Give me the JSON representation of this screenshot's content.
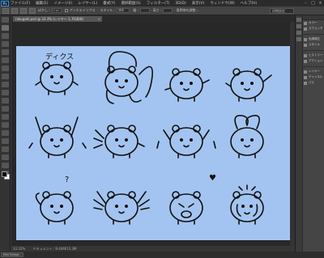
{
  "app": {
    "logo": "Ps"
  },
  "menu": [
    "ファイル(F)",
    "編集(E)",
    "イメージ(I)",
    "レイヤー(L)",
    "書式(Y)",
    "選択範囲(S)",
    "フィルター(T)",
    "3D(D)",
    "表示(V)",
    "ウィンドウ(W)",
    "ヘルプ(H)"
  ],
  "window_controls": {
    "minimize": "–",
    "maximize": "□",
    "close": "×"
  },
  "options": {
    "feather_label": "ぼかし :",
    "feather_value": "0 px",
    "antialias_label": "アンチエイリアス",
    "style_label": "スタイル :",
    "style_value": "標準",
    "width_label": "幅 :",
    "height_label": "高さ :",
    "refine_edge": "境界線を調整...",
    "workspace": "初期設定"
  },
  "document": {
    "tab_label": "rakugaki.psd @ 33.3% (レイヤー 1, RGB/8)",
    "tab_close": "×",
    "canvas_color": "#a3c4f0",
    "caption_text": "ディクス",
    "question_mark": "?",
    "heart": "♥"
  },
  "status": {
    "zoom": "33.33%",
    "doc_info": "ドキュメント : 9.44M/13.3M"
  },
  "bottom": {
    "mini_bridge": "Mini Bridge"
  },
  "panels": {
    "group1": [
      "カラー",
      "スウォッチ"
    ],
    "group2": [
      "色調補正",
      "スタイル"
    ],
    "group3": [
      "ヒストリー",
      "アクション"
    ],
    "group4": [
      "レイヤー",
      "チャンネル",
      "パス"
    ]
  },
  "icons": {
    "tools": "toolbox-icons",
    "panels": "panel-icons"
  }
}
